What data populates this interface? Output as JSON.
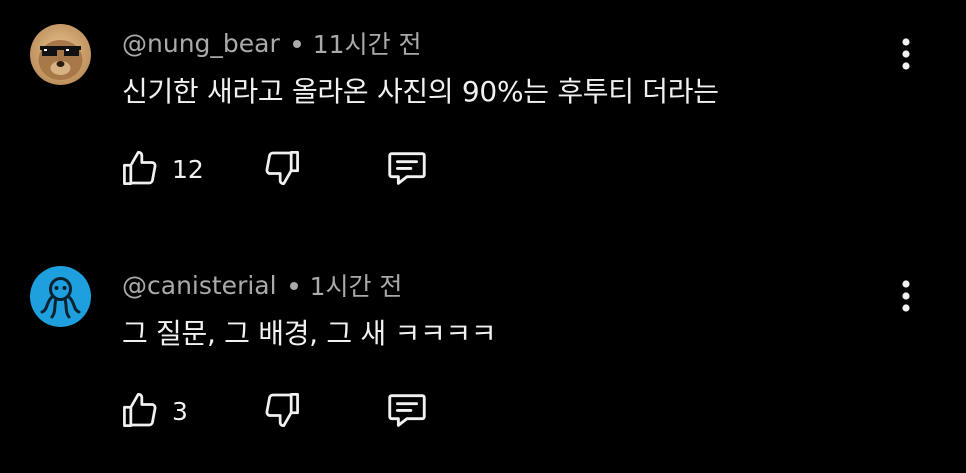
{
  "comments": [
    {
      "author": "@nung_bear",
      "time": "11시간 전",
      "text": "신기한 새라고 올라온 사진의 90%는 후투티 더라는",
      "likes": "12",
      "avatar_icon": "bear-with-sunglasses-avatar"
    },
    {
      "author": "@canisterial",
      "time": "1시간 전",
      "text": "그 질문, 그 배경, 그 새 ㅋㅋㅋㅋ",
      "likes": "3",
      "avatar_icon": "octopus-avatar"
    }
  ],
  "icons": {
    "like": "thumbs-up-icon",
    "dislike": "thumbs-down-icon",
    "reply": "reply-comment-icon",
    "more": "more-vertical-icon"
  },
  "colors": {
    "background": "#000000",
    "meta_text": "#aaaaaa",
    "body_text": "#f1f1f1",
    "avatar2_bg": "#1ea0de"
  }
}
